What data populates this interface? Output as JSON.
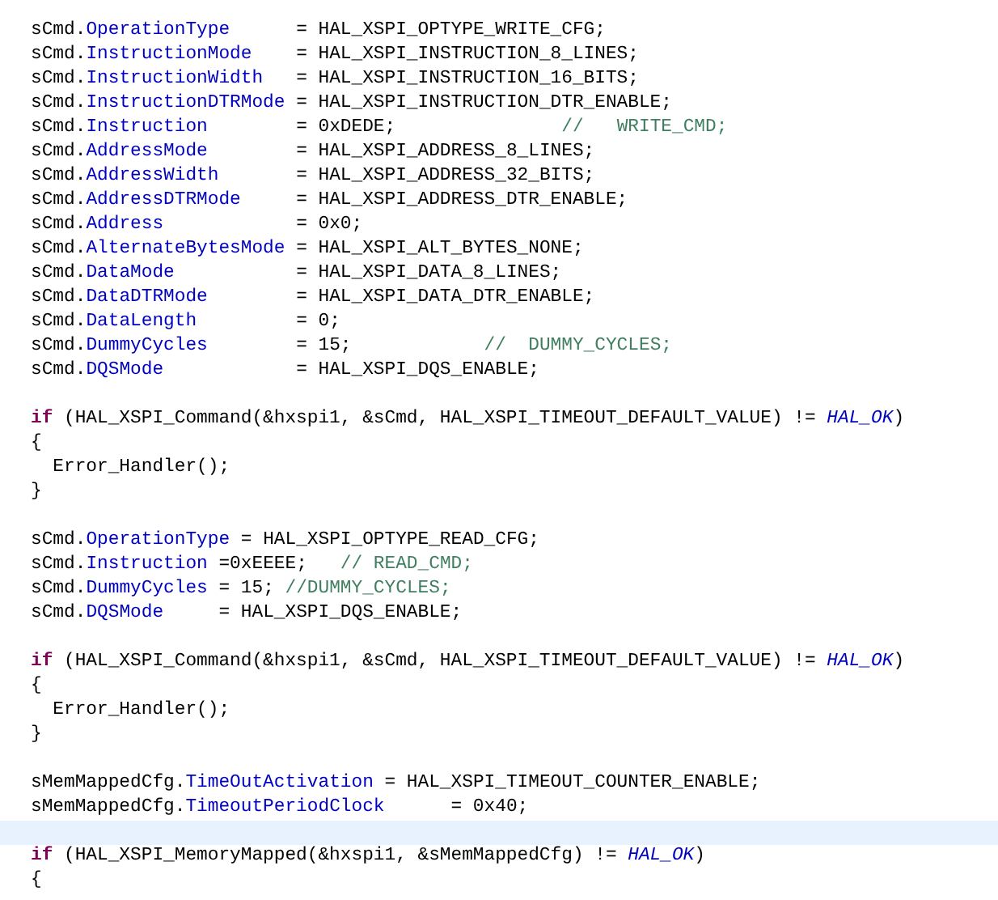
{
  "editor": {
    "lines": [
      {
        "kind": "code",
        "tokens": [
          {
            "kind": "text",
            "text": "sCmd."
          },
          {
            "kind": "field",
            "text": "OperationType"
          },
          {
            "kind": "text",
            "text": "      = HAL_XSPI_OPTYPE_WRITE_CFG;"
          }
        ]
      },
      {
        "kind": "code",
        "tokens": [
          {
            "kind": "text",
            "text": "sCmd."
          },
          {
            "kind": "field",
            "text": "InstructionMode"
          },
          {
            "kind": "text",
            "text": "    = HAL_XSPI_INSTRUCTION_8_LINES;"
          }
        ]
      },
      {
        "kind": "code",
        "tokens": [
          {
            "kind": "text",
            "text": "sCmd."
          },
          {
            "kind": "field",
            "text": "InstructionWidth"
          },
          {
            "kind": "text",
            "text": "   = HAL_XSPI_INSTRUCTION_16_BITS;"
          }
        ]
      },
      {
        "kind": "code",
        "tokens": [
          {
            "kind": "text",
            "text": "sCmd."
          },
          {
            "kind": "field",
            "text": "InstructionDTRMode"
          },
          {
            "kind": "text",
            "text": " = HAL_XSPI_INSTRUCTION_DTR_ENABLE;"
          }
        ]
      },
      {
        "kind": "code",
        "tokens": [
          {
            "kind": "text",
            "text": "sCmd."
          },
          {
            "kind": "field",
            "text": "Instruction"
          },
          {
            "kind": "text",
            "text": "        = 0xDEDE;               "
          },
          {
            "kind": "comment",
            "text": "//   WRITE_CMD;"
          }
        ]
      },
      {
        "kind": "code",
        "tokens": [
          {
            "kind": "text",
            "text": "sCmd."
          },
          {
            "kind": "field",
            "text": "AddressMode"
          },
          {
            "kind": "text",
            "text": "        = HAL_XSPI_ADDRESS_8_LINES;"
          }
        ]
      },
      {
        "kind": "code",
        "tokens": [
          {
            "kind": "text",
            "text": "sCmd."
          },
          {
            "kind": "field",
            "text": "AddressWidth"
          },
          {
            "kind": "text",
            "text": "       = HAL_XSPI_ADDRESS_32_BITS;"
          }
        ]
      },
      {
        "kind": "code",
        "tokens": [
          {
            "kind": "text",
            "text": "sCmd."
          },
          {
            "kind": "field",
            "text": "AddressDTRMode"
          },
          {
            "kind": "text",
            "text": "     = HAL_XSPI_ADDRESS_DTR_ENABLE;"
          }
        ]
      },
      {
        "kind": "code",
        "tokens": [
          {
            "kind": "text",
            "text": "sCmd."
          },
          {
            "kind": "field",
            "text": "Address"
          },
          {
            "kind": "text",
            "text": "            = 0x0;"
          }
        ]
      },
      {
        "kind": "code",
        "tokens": [
          {
            "kind": "text",
            "text": "sCmd."
          },
          {
            "kind": "field",
            "text": "AlternateBytesMode"
          },
          {
            "kind": "text",
            "text": " = HAL_XSPI_ALT_BYTES_NONE;"
          }
        ]
      },
      {
        "kind": "code",
        "tokens": [
          {
            "kind": "text",
            "text": "sCmd."
          },
          {
            "kind": "field",
            "text": "DataMode"
          },
          {
            "kind": "text",
            "text": "           = HAL_XSPI_DATA_8_LINES;"
          }
        ]
      },
      {
        "kind": "code",
        "tokens": [
          {
            "kind": "text",
            "text": "sCmd."
          },
          {
            "kind": "field",
            "text": "DataDTRMode"
          },
          {
            "kind": "text",
            "text": "        = HAL_XSPI_DATA_DTR_ENABLE;"
          }
        ]
      },
      {
        "kind": "code",
        "tokens": [
          {
            "kind": "text",
            "text": "sCmd."
          },
          {
            "kind": "field",
            "text": "DataLength"
          },
          {
            "kind": "text",
            "text": "         = 0;"
          }
        ]
      },
      {
        "kind": "code",
        "tokens": [
          {
            "kind": "text",
            "text": "sCmd."
          },
          {
            "kind": "field",
            "text": "DummyCycles"
          },
          {
            "kind": "text",
            "text": "        = 15;            "
          },
          {
            "kind": "comment",
            "text": "//  DUMMY_CYCLES;"
          }
        ]
      },
      {
        "kind": "code",
        "tokens": [
          {
            "kind": "text",
            "text": "sCmd."
          },
          {
            "kind": "field",
            "text": "DQSMode"
          },
          {
            "kind": "text",
            "text": "            = HAL_XSPI_DQS_ENABLE;"
          }
        ]
      },
      {
        "kind": "blank"
      },
      {
        "kind": "code",
        "tokens": [
          {
            "kind": "keyword",
            "text": "if"
          },
          {
            "kind": "text",
            "text": " (HAL_XSPI_Command(&hxspi1, &sCmd, HAL_XSPI_TIMEOUT_DEFAULT_VALUE) != "
          },
          {
            "kind": "constant",
            "text": "HAL_OK"
          },
          {
            "kind": "text",
            "text": ")"
          }
        ]
      },
      {
        "kind": "code",
        "tokens": [
          {
            "kind": "text",
            "text": "{"
          }
        ]
      },
      {
        "kind": "code",
        "tokens": [
          {
            "kind": "text",
            "text": "  Error_Handler();"
          }
        ]
      },
      {
        "kind": "code",
        "tokens": [
          {
            "kind": "text",
            "text": "}"
          }
        ]
      },
      {
        "kind": "blank"
      },
      {
        "kind": "code",
        "tokens": [
          {
            "kind": "text",
            "text": "sCmd."
          },
          {
            "kind": "field",
            "text": "OperationType"
          },
          {
            "kind": "text",
            "text": " = HAL_XSPI_OPTYPE_READ_CFG;"
          }
        ]
      },
      {
        "kind": "code",
        "tokens": [
          {
            "kind": "text",
            "text": "sCmd."
          },
          {
            "kind": "field",
            "text": "Instruction"
          },
          {
            "kind": "text",
            "text": " =0xEEEE;   "
          },
          {
            "kind": "comment",
            "text": "// READ_CMD;"
          }
        ]
      },
      {
        "kind": "code",
        "tokens": [
          {
            "kind": "text",
            "text": "sCmd."
          },
          {
            "kind": "field",
            "text": "DummyCycles"
          },
          {
            "kind": "text",
            "text": " = 15; "
          },
          {
            "kind": "comment",
            "text": "//DUMMY_CYCLES;"
          }
        ]
      },
      {
        "kind": "code",
        "tokens": [
          {
            "kind": "text",
            "text": "sCmd."
          },
          {
            "kind": "field",
            "text": "DQSMode"
          },
          {
            "kind": "text",
            "text": "     = HAL_XSPI_DQS_ENABLE;"
          }
        ]
      },
      {
        "kind": "blank"
      },
      {
        "kind": "code",
        "tokens": [
          {
            "kind": "keyword",
            "text": "if"
          },
          {
            "kind": "text",
            "text": " (HAL_XSPI_Command(&hxspi1, &sCmd, HAL_XSPI_TIMEOUT_DEFAULT_VALUE) != "
          },
          {
            "kind": "constant",
            "text": "HAL_OK"
          },
          {
            "kind": "text",
            "text": ")"
          }
        ]
      },
      {
        "kind": "code",
        "tokens": [
          {
            "kind": "text",
            "text": "{"
          }
        ]
      },
      {
        "kind": "code",
        "tokens": [
          {
            "kind": "text",
            "text": "  Error_Handler();"
          }
        ]
      },
      {
        "kind": "code",
        "tokens": [
          {
            "kind": "text",
            "text": "}"
          }
        ]
      },
      {
        "kind": "blank"
      },
      {
        "kind": "code",
        "tokens": [
          {
            "kind": "text",
            "text": "sMemMappedCfg."
          },
          {
            "kind": "field",
            "text": "TimeOutActivation"
          },
          {
            "kind": "text",
            "text": " = HAL_XSPI_TIMEOUT_COUNTER_ENABLE;"
          }
        ]
      },
      {
        "kind": "code",
        "tokens": [
          {
            "kind": "text",
            "text": "sMemMappedCfg."
          },
          {
            "kind": "field",
            "text": "TimeoutPeriodClock"
          },
          {
            "kind": "text",
            "text": "      = 0x40;"
          }
        ]
      },
      {
        "kind": "current_line"
      },
      {
        "kind": "code",
        "tokens": [
          {
            "kind": "keyword",
            "text": "if"
          },
          {
            "kind": "text",
            "text": " (HAL_XSPI_MemoryMapped(&hxspi1, &sMemMappedCfg) != "
          },
          {
            "kind": "constant",
            "text": "HAL_OK"
          },
          {
            "kind": "text",
            "text": ")"
          }
        ]
      },
      {
        "kind": "code",
        "tokens": [
          {
            "kind": "text",
            "text": "{"
          }
        ]
      }
    ]
  }
}
